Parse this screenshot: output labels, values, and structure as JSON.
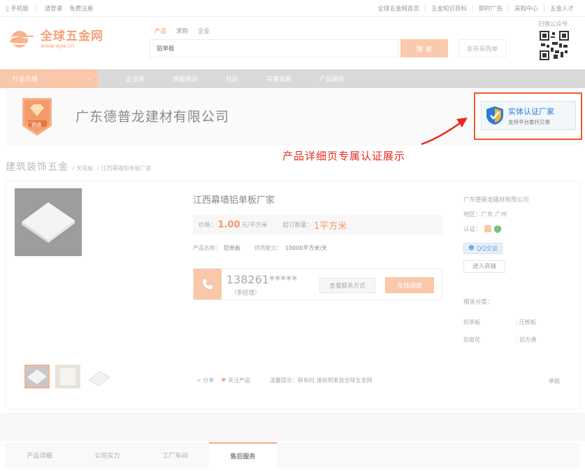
{
  "topbar": {
    "mobile": "手机版",
    "login": "请登录",
    "register": "免费注册",
    "links": [
      "全球五金网首页",
      "五金知识百科",
      "即时广告",
      "采购中心",
      "五金人才"
    ]
  },
  "header": {
    "logo_text": "全球五金网",
    "logo_url": "www.wjw.cn",
    "search_tabs": [
      "产品",
      "求购",
      "企业"
    ],
    "search_value": "铝单板",
    "search_button": "搜 索",
    "post_button": "发布采购单",
    "qr_label": "扫微公众号"
  },
  "nav": {
    "category": "行业市场",
    "items": [
      "企业库",
      "情报资讯",
      "社区",
      "买家采购",
      "产品报价"
    ]
  },
  "company": {
    "badge_text": "厂销通",
    "name": "广东德普龙建材有限公司",
    "cert_title": "实体认证厂家",
    "cert_sub": "支持平台委托交易"
  },
  "annotation": "产品详细页专属认证展示",
  "breadcrumb": {
    "category": "建筑装饰五金",
    "path": [
      "/ 天花板",
      "/ 江西幕墙铝单板厂家"
    ]
  },
  "product": {
    "title": "江西幕墙铝单板厂家",
    "price_label": "价格：",
    "price": "1.00",
    "price_unit": "元/平方米",
    "moq_label": "起订数量：",
    "moq": "1平方米",
    "name_label": "产品名称：",
    "name_value": "铝单板",
    "supply_label": "供货能力：",
    "supply_value": "10000平方米/天",
    "phone": "138261*****",
    "contact_name": "（李经理）",
    "view_contact": "查看联系方式",
    "inquiry": "在线询盘",
    "share": "分享",
    "follow": "关注产品",
    "tip": "温馨提示：联系时,请说明来自全球五金网",
    "report": "举报"
  },
  "seller": {
    "company": "广东德普龙建材有限公司",
    "region": "地区：广东 广州",
    "cert_label": "认证：",
    "qq": "QQ交谈",
    "shop": "进入商铺",
    "related_label": "相关分类：",
    "related": [
      "铝单板",
      "压楔板",
      "铝窗花",
      "铝方通"
    ]
  },
  "bottom_tabs": [
    "产品详细",
    "公司实力",
    "工厂车间",
    "售后服务"
  ],
  "colors": {
    "accent": "#f39c6b",
    "accent_light": "#f9c7aa",
    "annotation": "#e8291e",
    "cert_border": "#f25a2a",
    "cert_blue": "#2a7bd6"
  }
}
